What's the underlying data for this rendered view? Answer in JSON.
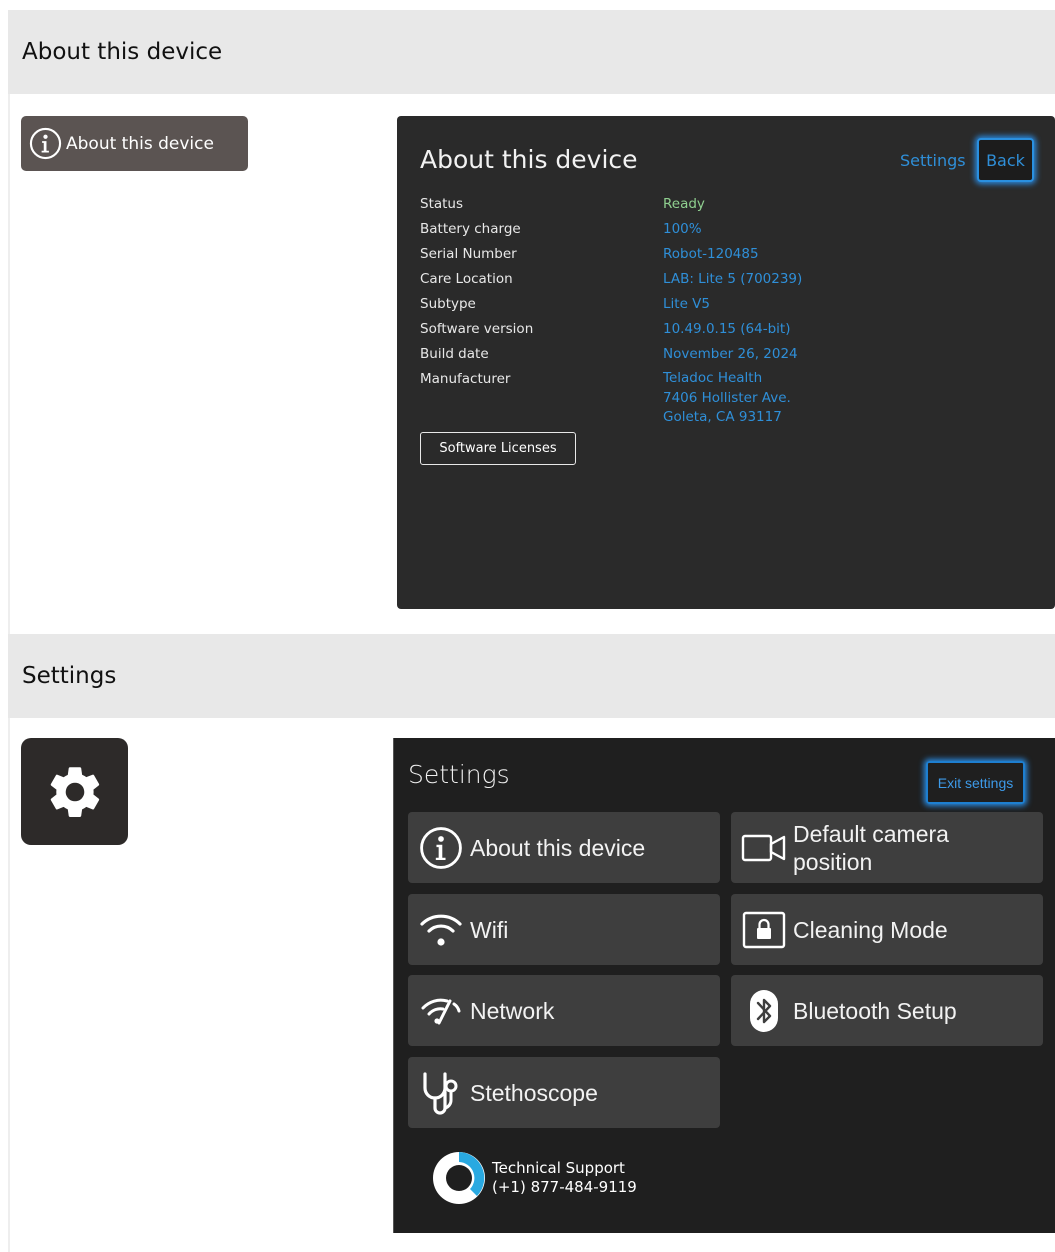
{
  "sections": {
    "about_title": "About this device",
    "settings_title": "Settings"
  },
  "about_pill": {
    "label": "About this device",
    "icon": "info-icon"
  },
  "about_panel": {
    "title": "About this device",
    "settings_link": "Settings",
    "back_button": "Back",
    "rows": [
      {
        "key": "Status",
        "value": "Ready"
      },
      {
        "key": "Battery charge",
        "value": "100%"
      },
      {
        "key": "Serial Number",
        "value": "Robot-120485"
      },
      {
        "key": "Care Location",
        "value": "LAB: Lite 5 (700239)"
      },
      {
        "key": "Subtype",
        "value": "Lite V5"
      },
      {
        "key": "Software version",
        "value": "10.49.0.15 (64-bit)"
      },
      {
        "key": "Build date",
        "value": "November 26, 2024"
      }
    ],
    "manufacturer_key": "Manufacturer",
    "manufacturer_lines": [
      "Teladoc Health",
      "7406 Hollister Ave.",
      "Goleta, CA 93117"
    ],
    "licenses_button": "Software Licenses"
  },
  "gear_tile": {
    "icon": "gear-icon"
  },
  "settings_panel": {
    "title": "Settings",
    "exit_button": "Exit settings",
    "tiles": [
      {
        "label": "About this device",
        "icon": "info-icon"
      },
      {
        "label": "Default camera position",
        "icon": "video-camera-icon"
      },
      {
        "label": "Wifi",
        "icon": "wifi-icon"
      },
      {
        "label": "Cleaning Mode",
        "icon": "lock-icon"
      },
      {
        "label": "Network",
        "icon": "network-icon"
      },
      {
        "label": "Bluetooth Setup",
        "icon": "bluetooth-icon"
      },
      {
        "label": "Stethoscope",
        "icon": "stethoscope-icon"
      }
    ],
    "support": {
      "line1": "Technical Support",
      "line2": "(+1) 877-484-9119"
    }
  },
  "colors": {
    "accent": "#2f8fd8",
    "ready": "#8fcf8f",
    "panel": "#2a2a2a"
  }
}
